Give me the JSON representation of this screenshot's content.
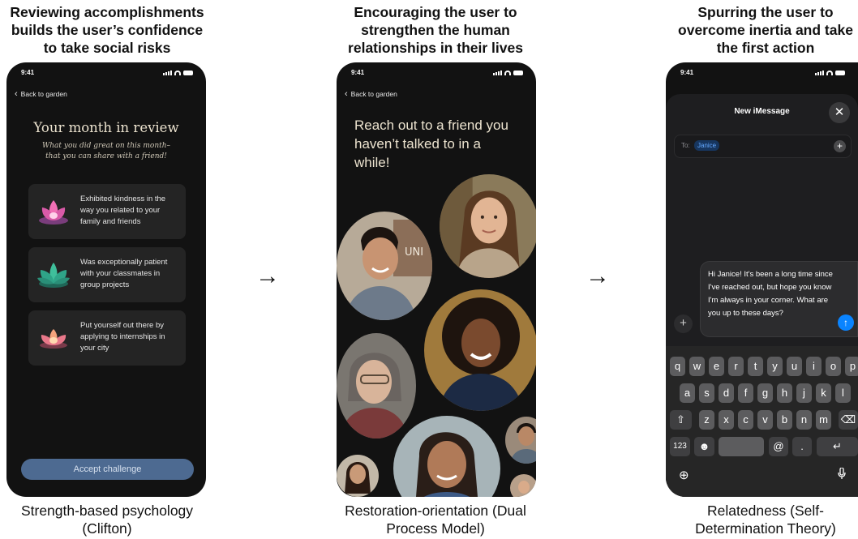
{
  "captions_top": [
    "Reviewing accomplishments\nbuilds the user’s confidence\nto take social risks",
    "Encouraging the user to\nstrengthen the human\nrelationships in their lives",
    "Spurring the user to\novercome inertia and take\nthe first action"
  ],
  "captions_bottom": [
    "Strength-based psychology\n(Clifton)",
    "Restoration-orientation (Dual\nProcess Model)",
    "Relatedness (Self-\nDetermination Theory)"
  ],
  "arrow": "→",
  "status_time": "9:41",
  "phone1": {
    "back_label": "Back to garden",
    "title": "Your month in review",
    "subtitle": "What you did great on this month–\nthat you can share with a friend!",
    "cards": [
      {
        "text": "Exhibited kindness in the way you related to your family and friends",
        "icon": "pink-lotus-icon"
      },
      {
        "text": "Was exceptionally patient with your classmates in group projects",
        "icon": "teal-lotus-icon"
      },
      {
        "text": "Put yourself out there by applying to internships in your city",
        "icon": "peach-lotus-icon"
      }
    ],
    "accept_label": "Accept challenge"
  },
  "phone2": {
    "back_label": "Back to garden",
    "title": "Reach out to a friend you haven’t talked to in a while!",
    "photo_sign": "UNI"
  },
  "phone3": {
    "sheet_title": "New iMessage",
    "to_label": "To:",
    "recipient": "Janice",
    "message": "Hi Janice! It's been a long time since I've reached out, but hope you know I'm always in your corner. What are you up to these days?",
    "keyboard": {
      "row1": [
        "q",
        "w",
        "e",
        "r",
        "t",
        "y",
        "u",
        "i",
        "o",
        "p"
      ],
      "row2": [
        "a",
        "s",
        "d",
        "f",
        "g",
        "h",
        "j",
        "k",
        "l"
      ],
      "row3": [
        "z",
        "x",
        "c",
        "v",
        "b",
        "n",
        "m"
      ],
      "numbers_key": "123",
      "at_key": "@",
      "dot_key": "."
    }
  },
  "colors": {
    "accent_blue": "#0a84ff",
    "accept_button": "#4d6a91",
    "title_cream": "#ece3cf"
  }
}
